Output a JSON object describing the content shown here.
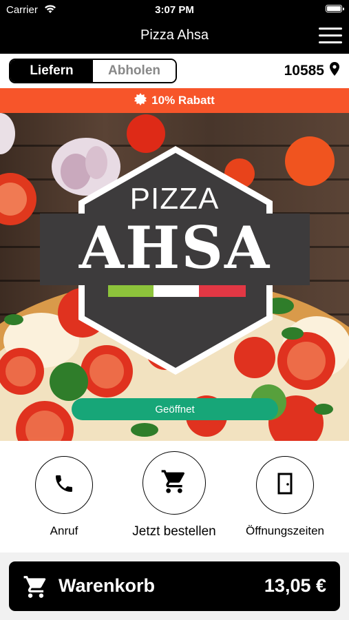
{
  "status_bar": {
    "carrier": "Carrier",
    "time": "3:07 PM"
  },
  "header": {
    "title": "Pizza Ahsa"
  },
  "mode": {
    "options": [
      "Liefern",
      "Abholen"
    ],
    "selected": "Liefern"
  },
  "location": {
    "postcode": "10585"
  },
  "promo": {
    "text": "10% Rabatt"
  },
  "hero": {
    "logo_line1": "PIZZA",
    "logo_line2": "AHSA",
    "flag_colors": [
      "#8dc33b",
      "#ffffff",
      "#e23744"
    ],
    "status_button": "Geöffnet"
  },
  "actions": [
    {
      "label": "Anruf",
      "icon": "phone-icon"
    },
    {
      "label": "Jetzt bestellen",
      "icon": "cart-icon"
    },
    {
      "label": "Öffnungszeiten",
      "icon": "door-icon"
    }
  ],
  "cart": {
    "label": "Warenkorb",
    "total": "13,05 €"
  },
  "colors": {
    "accent_orange": "#f7552a",
    "open_green": "#17a678",
    "dark": "#000000"
  }
}
